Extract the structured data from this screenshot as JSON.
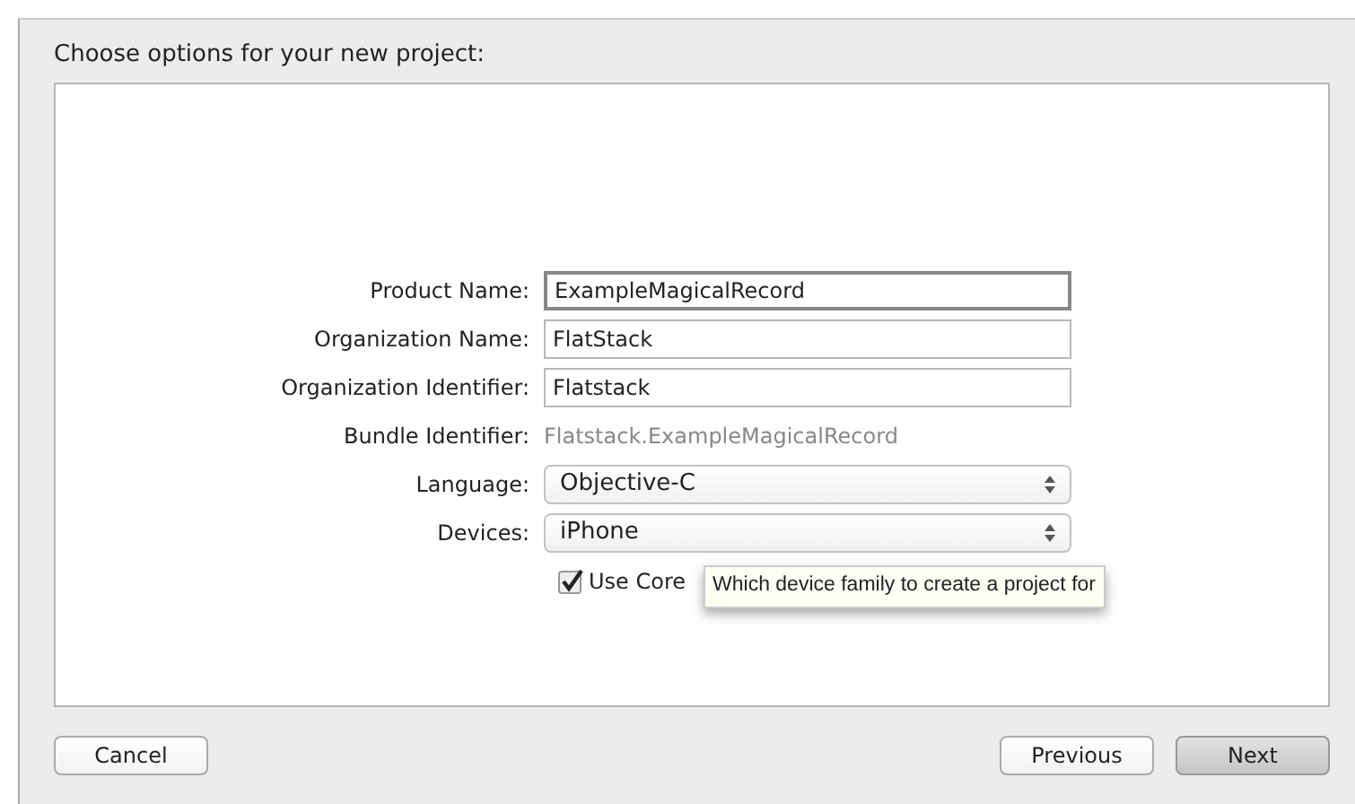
{
  "heading": "Choose options for your new project:",
  "fields": [
    {
      "kind": "text",
      "label": "Product Name:",
      "value": "ExampleMagicalRecord",
      "focused": true
    },
    {
      "kind": "text",
      "label": "Organization Name:",
      "value": "FlatStack",
      "focused": false
    },
    {
      "kind": "text",
      "label": "Organization Identifier:",
      "value": "Flatstack",
      "focused": false
    },
    {
      "kind": "static",
      "label": "Bundle Identifier:",
      "value": "Flatstack.ExampleMagicalRecord"
    },
    {
      "kind": "popup",
      "label": "Language:",
      "value": "Objective-C"
    },
    {
      "kind": "popup",
      "label": "Devices:",
      "value": "iPhone"
    },
    {
      "kind": "checkbox",
      "value": "Use Core",
      "checked": true
    }
  ],
  "tooltip": "Which device family to create a project for",
  "left_buttons": [
    {
      "label": "Cancel",
      "default": false
    }
  ],
  "right_buttons": [
    {
      "label": "Previous",
      "default": false
    },
    {
      "label": "Next",
      "default": true
    }
  ]
}
